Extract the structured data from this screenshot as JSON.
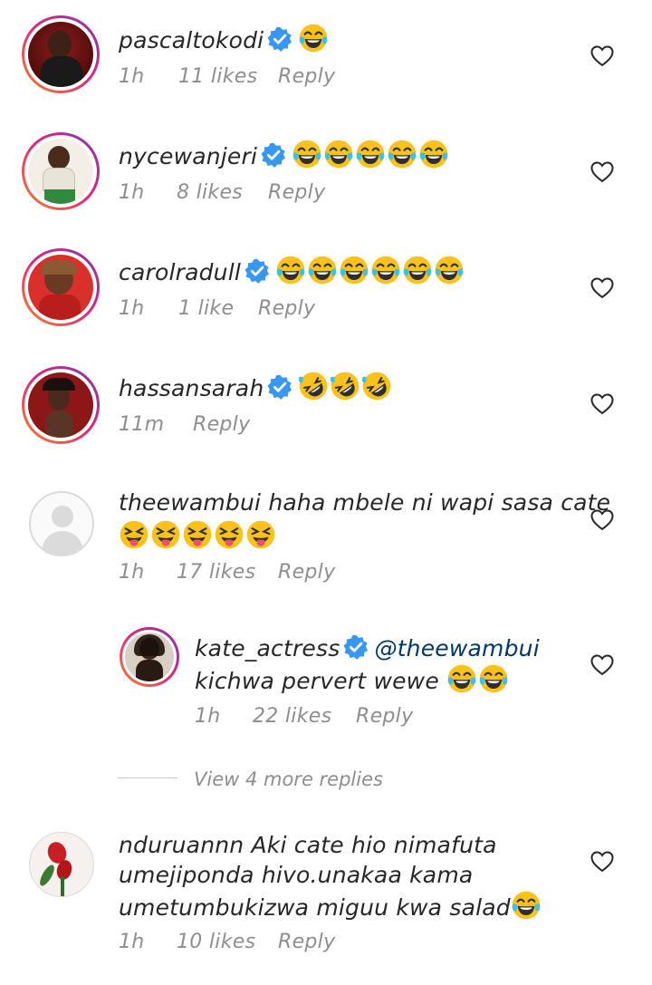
{
  "comments": [
    {
      "username": "pascaltokodi",
      "verified": true,
      "text": "",
      "emoji": "joy",
      "emoji_count": 1,
      "time": "1h",
      "likes": "11 likes",
      "reply": "Reply"
    },
    {
      "username": "nycewanjeri",
      "verified": true,
      "text": "",
      "emoji": "joy",
      "emoji_count": 5,
      "time": "1h",
      "likes": "8 likes",
      "reply": "Reply"
    },
    {
      "username": "carolradull",
      "verified": true,
      "text": "",
      "emoji": "joy",
      "emoji_count": 6,
      "time": "1h",
      "likes": "1 like",
      "reply": "Reply"
    },
    {
      "username": "hassansarah",
      "verified": true,
      "text": "",
      "emoji": "rofl",
      "emoji_count": 3,
      "time": "11m",
      "likes": "",
      "reply": "Reply"
    },
    {
      "username": "theewambui",
      "verified": false,
      "text": "haha mbele ni wapi sasa cate",
      "emoji": "squint-tongue",
      "emoji_count": 5,
      "time": "1h",
      "likes": "17 likes",
      "reply": "Reply"
    },
    {
      "username": "kate_actress",
      "verified": true,
      "mention": "@theewambui",
      "text": "kichwa pervert wewe",
      "emoji": "joy",
      "emoji_count": 2,
      "time": "1h",
      "likes": "22 likes",
      "reply": "Reply"
    },
    {
      "username": "nduruannn",
      "verified": false,
      "text_lines": [
        "Aki cate hio nimafuta",
        "umejiponda hivo.unakaa kama",
        "umetumbukizwa miguu kwa salad"
      ],
      "emoji": "joy",
      "emoji_count": 1,
      "time": "1h",
      "likes": "10 likes",
      "reply": "Reply"
    }
  ],
  "view_more_replies": "View 4 more replies",
  "icons": {
    "like": "heart-outline-icon",
    "verified": "verified-badge-icon"
  },
  "colors": {
    "verified": "#3897f0",
    "mention": "#00376b",
    "meta": "#8e8e8e"
  }
}
